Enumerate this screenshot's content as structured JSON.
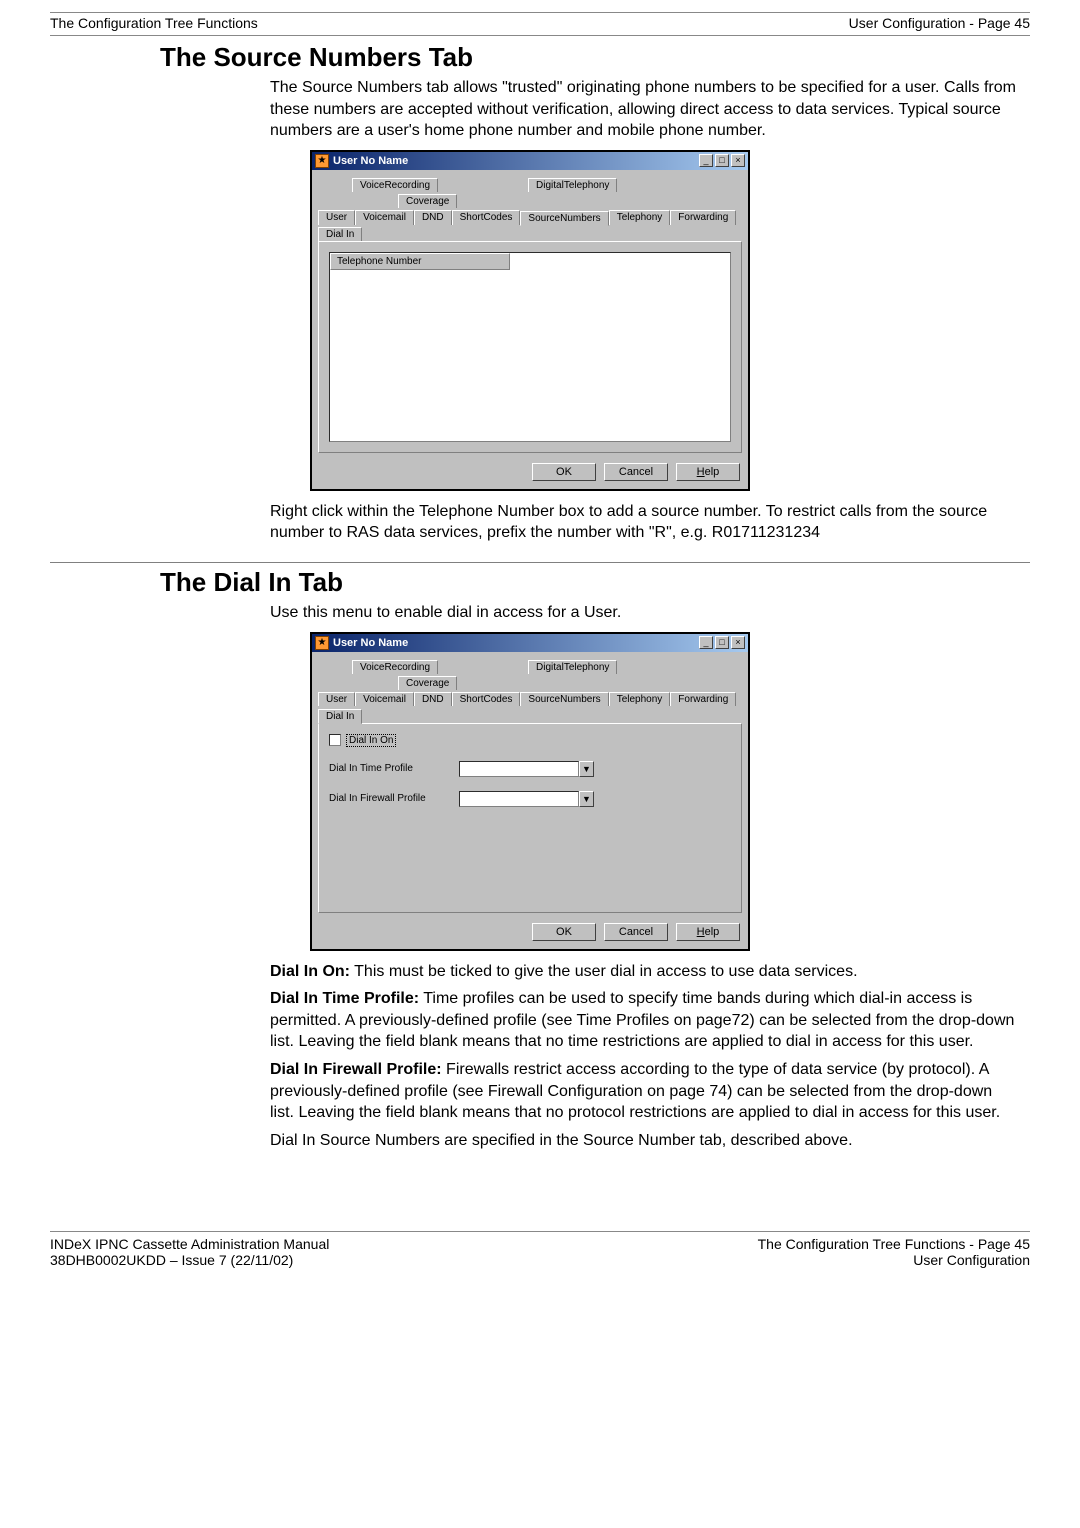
{
  "header": {
    "left": "The Configuration Tree Functions",
    "right": "User Configuration - Page 45"
  },
  "section1": {
    "title": "The Source Numbers Tab",
    "p1": "The Source Numbers tab allows \"trusted\" originating phone numbers to be specified for a user. Calls from these numbers are accepted without verification, allowing direct access to data services. Typical source numbers are a user's home phone number and mobile phone number.",
    "p2": "Right click within the Telephone Number box to add a source number. To restrict calls from the source number to RAS data services, prefix the number with \"R\", e.g. R01711231234"
  },
  "section2": {
    "title": "The Dial In Tab",
    "p1": "Use this menu to enable dial in access for a User.",
    "dial_in_on_label": "Dial In On:",
    "dial_in_on_text": " This must be ticked to give the user dial in access to use data services.",
    "time_profile_label": "Dial In Time Profile:",
    "time_profile_text": " Time profiles can be used to specify time bands during which dial-in access is permitted. A previously-defined profile (see Time Profiles on page72) can be selected from the drop-down list. Leaving the field blank means that no time restrictions are applied to dial in access for this user.",
    "fw_profile_label": "Dial In Firewall Profile:",
    "fw_profile_text": " Firewalls restrict access according to the type of data service (by protocol). A previously-defined profile (see Firewall Configuration on page 74) can be selected from the drop-down list. Leaving the field blank means that no protocol restrictions are applied to dial in access for this user.",
    "p5": "Dial In Source Numbers are specified in the Source Number tab, described above."
  },
  "window": {
    "title": "User No Name",
    "tabs": {
      "user": "User",
      "voicemail": "Voicemail",
      "voicerec": "VoiceRecording",
      "dnd": "DND",
      "shortcodes": "ShortCodes",
      "sourcenum": "SourceNumbers",
      "digtel": "DigitalTelephony",
      "telephony": "Telephony",
      "forwarding": "Forwarding",
      "coverage": "Coverage",
      "dialin": "Dial In"
    },
    "listheader": "Telephone Number",
    "buttons": {
      "ok": "OK",
      "cancel": "Cancel",
      "help": "Help",
      "help_u": "H"
    },
    "form": {
      "dialinon": "Dial In On",
      "timeprofile": "Dial In Time Profile",
      "fwprofile": "Dial In Firewall Profile"
    }
  },
  "footer": {
    "l1": "INDeX IPNC Cassette Administration Manual",
    "l2": "38DHB0002UKDD – Issue 7 (22/11/02)",
    "r1": "The Configuration Tree Functions - Page 45",
    "r2": "User Configuration"
  }
}
